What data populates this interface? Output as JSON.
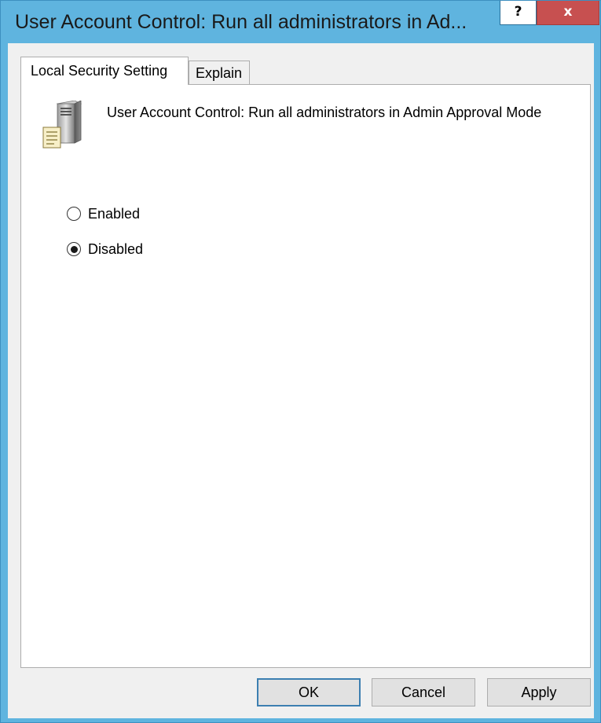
{
  "window": {
    "title": "User Account Control: Run all administrators in Ad...",
    "help_label": "?",
    "close_label": "x",
    "frame_color": "#5fb4df",
    "close_color": "#c75050"
  },
  "tabs": [
    {
      "label": "Local Security Setting",
      "selected": true
    },
    {
      "label": "Explain",
      "selected": false
    }
  ],
  "panel": {
    "icon": "server-policy-icon",
    "policy_title": "User Account Control: Run all administrators in Admin Approval Mode",
    "options": [
      {
        "label": "Enabled",
        "checked": false
      },
      {
        "label": "Disabled",
        "checked": true
      }
    ]
  },
  "buttons": {
    "ok": "OK",
    "cancel": "Cancel",
    "apply": "Apply"
  }
}
